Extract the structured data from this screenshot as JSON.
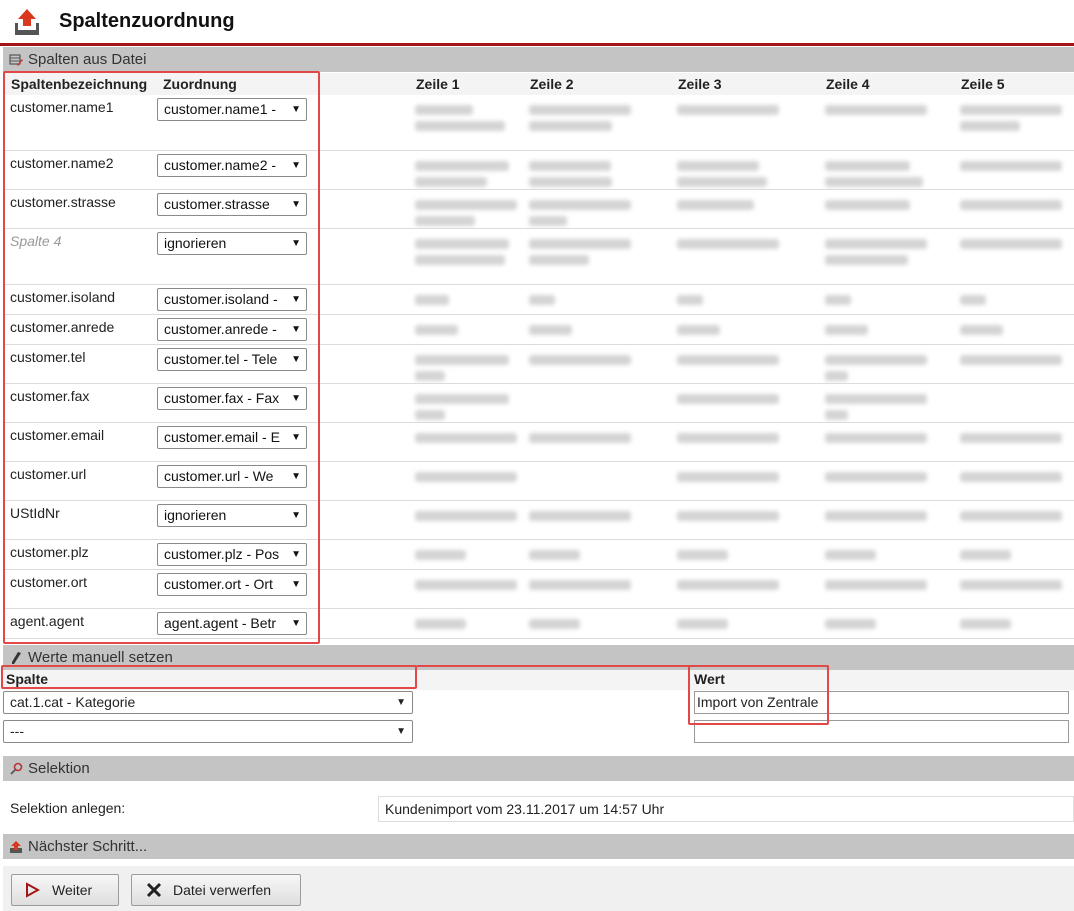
{
  "header": {
    "title": "Spaltenzuordnung"
  },
  "sections": {
    "file_columns": "Spalten aus Datei",
    "manual_values": "Werte manuell setzen",
    "selection": "Selektion",
    "next_step": "Nächster Schritt..."
  },
  "mapping_table": {
    "headers": [
      "Spaltenbezeichnung",
      "Zuordnung",
      "Zeile 1",
      "Zeile 2",
      "Zeile 3",
      "Zeile 4",
      "Zeile 5"
    ],
    "rows": [
      {
        "name": "customer.name1",
        "mapping": "customer.name1 - "
      },
      {
        "name": "customer.name2",
        "mapping": "customer.name2 - "
      },
      {
        "name": "customer.strasse",
        "mapping": "customer.strasse"
      },
      {
        "name": "Spalte 4",
        "mapping": "ignorieren"
      },
      {
        "name": "customer.isoland",
        "mapping": "customer.isoland -"
      },
      {
        "name": "customer.anrede",
        "mapping": "customer.anrede -"
      },
      {
        "name": "customer.tel",
        "mapping": "customer.tel - Tele"
      },
      {
        "name": "customer.fax",
        "mapping": "customer.fax - Fax"
      },
      {
        "name": "customer.email",
        "mapping": "customer.email - E"
      },
      {
        "name": "customer.url",
        "mapping": "customer.url - We"
      },
      {
        "name": "UStIdNr",
        "mapping": "ignorieren"
      },
      {
        "name": "customer.plz",
        "mapping": "customer.plz - Pos"
      },
      {
        "name": "customer.ort",
        "mapping": "customer.ort - Ort"
      },
      {
        "name": "agent.agent",
        "mapping": "agent.agent - Betr"
      }
    ]
  },
  "manual_values": {
    "column_header": "Spalte",
    "value_header": "Wert",
    "rows": [
      {
        "column": "cat.1.cat - Kategorie",
        "value": "Import von Zentrale"
      },
      {
        "column": "---",
        "value": ""
      }
    ]
  },
  "selection": {
    "label": "Selektion anlegen:",
    "value": "Kundenimport vom 23.11.2017 um 14:57 Uhr"
  },
  "buttons": {
    "next": "Weiter",
    "discard": "Datei verwerfen"
  },
  "colors": {
    "accent": "#a31515",
    "highlight": "#e34848",
    "section_bar": "#c4c4c4"
  },
  "icons": [
    "upload-icon",
    "table-edit-icon",
    "pencil-icon",
    "key-icon",
    "play-icon",
    "close-icon"
  ]
}
